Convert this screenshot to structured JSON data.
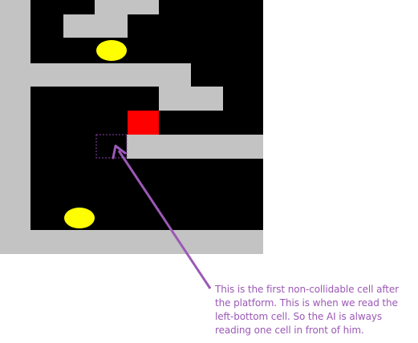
{
  "colors": {
    "background": "#ffffff",
    "void": "#000000",
    "wall": "#c3c3c3",
    "coin": "#ffff00",
    "player": "#ff0000",
    "annotation": "#9b59b6"
  },
  "game": {
    "tiles": [
      "wall",
      "void",
      "platform",
      "coin",
      "player",
      "highlighted-cell"
    ],
    "coins_visible": 2,
    "player_visible": 1
  },
  "annotation": {
    "lines": [
      "This is the first non-collidable cell after",
      "the platform. This is when we read the",
      "left-bottom cell. So the AI is always",
      "reading one cell in front of him."
    ]
  }
}
